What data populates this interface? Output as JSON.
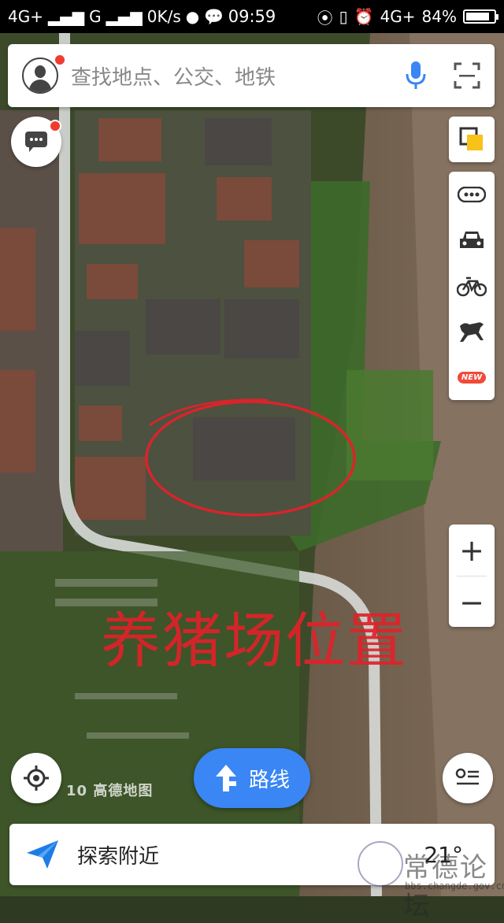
{
  "status_bar": {
    "network1": "4G+",
    "network2": "G",
    "speed": "0K/s",
    "time": "09:59",
    "network3": "4G+",
    "battery": "84%",
    "battery_level": 0.84
  },
  "search": {
    "placeholder": "查找地点、公交、地铁"
  },
  "map": {
    "annotation": "养猪场位置",
    "logo": "10 高德地图"
  },
  "controls": {
    "zoom_in": "+",
    "zoom_out": "−",
    "new_badge": "NEW"
  },
  "route_button": {
    "label": "路线"
  },
  "bottom_bar": {
    "label": "探索附近",
    "temperature": "21°"
  },
  "watermark": {
    "title": "常德论坛",
    "url": "bbs.changde.gov.cn"
  },
  "colors": {
    "accent": "#3a86f4",
    "annotation": "#e0222a",
    "red_dot": "#f03c2e"
  }
}
